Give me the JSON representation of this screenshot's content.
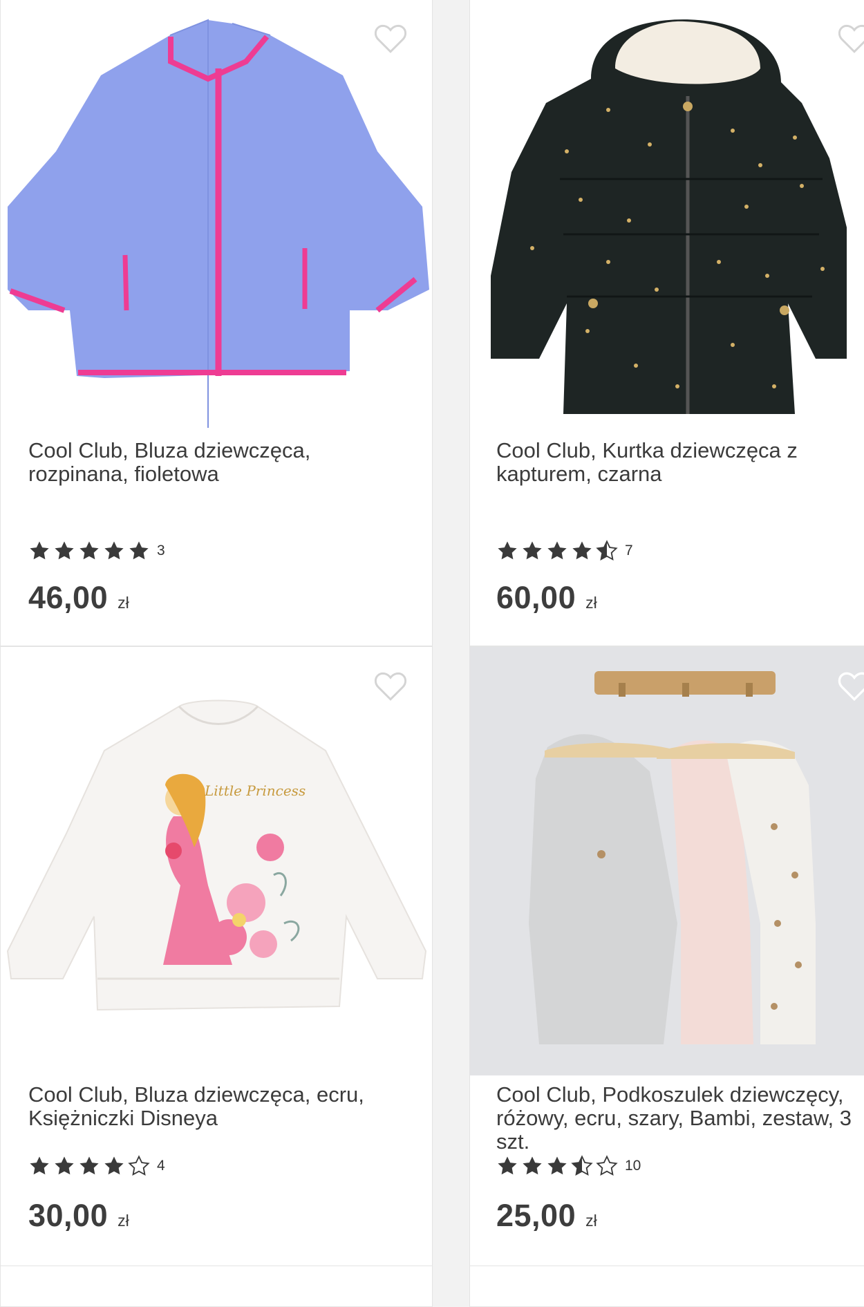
{
  "products": [
    {
      "title": "Cool Club, Bluza dziewczęca, rozpinana, fioletowa",
      "rating": 5,
      "review_count": "3",
      "price": "46,00",
      "currency": "zł",
      "favorite_icon": "heart-outline-icon"
    },
    {
      "title": "Cool Club, Kurtka dziewczęca z kapturem, czarna",
      "rating": 4.5,
      "review_count": "7",
      "price": "60,00",
      "currency": "zł",
      "favorite_icon": "heart-outline-icon"
    },
    {
      "title": "Cool Club, Bluza dziewczęca, ecru, Księżniczki Disneya",
      "rating": 4,
      "review_count": "4",
      "price": "30,00",
      "currency": "zł",
      "favorite_icon": "heart-outline-icon"
    },
    {
      "title": "Cool Club, Podkoszulek dziewczęcy, różowy, ecru, szary, Bambi, zestaw, 3 szt.",
      "rating": 3.5,
      "review_count": "10",
      "price": "25,00",
      "currency": "zł",
      "favorite_icon": "heart-outline-icon"
    }
  ],
  "colors": {
    "star_fill": "#3a3a3a",
    "page_background": "#f2f2f2",
    "card_background": "#ffffff"
  }
}
